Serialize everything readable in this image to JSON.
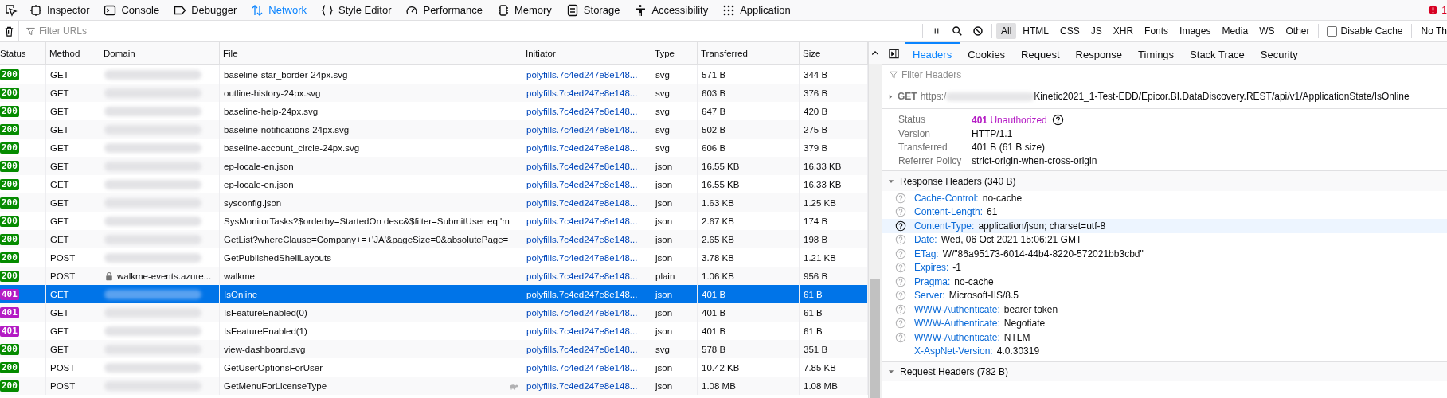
{
  "toolbox_tabs": [
    {
      "label": "Inspector",
      "selected": false
    },
    {
      "label": "Console",
      "selected": false
    },
    {
      "label": "Debugger",
      "selected": false
    },
    {
      "label": "Network",
      "selected": true
    },
    {
      "label": "Style Editor",
      "selected": false
    },
    {
      "label": "Performance",
      "selected": false
    },
    {
      "label": "Memory",
      "selected": false
    },
    {
      "label": "Storage",
      "selected": false
    },
    {
      "label": "Accessibility",
      "selected": false
    },
    {
      "label": "Application",
      "selected": false
    }
  ],
  "error_count": "1",
  "filter_bar": {
    "placeholder": "Filter URLs",
    "types": [
      {
        "label": "All",
        "selected": true
      },
      {
        "label": "HTML",
        "selected": false
      },
      {
        "label": "CSS",
        "selected": false
      },
      {
        "label": "JS",
        "selected": false
      },
      {
        "label": "XHR",
        "selected": false
      },
      {
        "label": "Fonts",
        "selected": false
      },
      {
        "label": "Images",
        "selected": false
      },
      {
        "label": "Media",
        "selected": false
      },
      {
        "label": "WS",
        "selected": false
      },
      {
        "label": "Other",
        "selected": false
      }
    ],
    "disable_cache": {
      "label": "Disable Cache",
      "checked": false
    },
    "throttle": "No Th"
  },
  "table": {
    "columns": [
      "Status",
      "Method",
      "Domain",
      "File",
      "Initiator",
      "Type",
      "Transferred",
      "Size"
    ],
    "rows": [
      {
        "status": "200",
        "color": "#058b00",
        "method": "GET",
        "domain_redacted": true,
        "file": "baseline-star_border-24px.svg",
        "initiator": "polyfills.7c4ed247e8e148...",
        "type": "svg",
        "transferred": "571 B",
        "size": "344 B",
        "selected": false
      },
      {
        "status": "200",
        "color": "#058b00",
        "method": "GET",
        "domain_redacted": true,
        "file": "outline-history-24px.svg",
        "initiator": "polyfills.7c4ed247e8e148...",
        "type": "svg",
        "transferred": "603 B",
        "size": "376 B",
        "selected": false
      },
      {
        "status": "200",
        "color": "#058b00",
        "method": "GET",
        "domain_redacted": true,
        "file": "baseline-help-24px.svg",
        "initiator": "polyfills.7c4ed247e8e148...",
        "type": "svg",
        "transferred": "647 B",
        "size": "420 B",
        "selected": false
      },
      {
        "status": "200",
        "color": "#058b00",
        "method": "GET",
        "domain_redacted": true,
        "file": "baseline-notifications-24px.svg",
        "initiator": "polyfills.7c4ed247e8e148...",
        "type": "svg",
        "transferred": "502 B",
        "size": "275 B",
        "selected": false
      },
      {
        "status": "200",
        "color": "#058b00",
        "method": "GET",
        "domain_redacted": true,
        "file": "baseline-account_circle-24px.svg",
        "initiator": "polyfills.7c4ed247e8e148...",
        "type": "svg",
        "transferred": "606 B",
        "size": "379 B",
        "selected": false
      },
      {
        "status": "200",
        "color": "#058b00",
        "method": "GET",
        "domain_redacted": true,
        "file": "ep-locale-en.json",
        "initiator": "polyfills.7c4ed247e8e148...",
        "type": "json",
        "transferred": "16.55 KB",
        "size": "16.33 KB",
        "selected": false
      },
      {
        "status": "200",
        "color": "#058b00",
        "method": "GET",
        "domain_redacted": true,
        "file": "ep-locale-en.json",
        "initiator": "polyfills.7c4ed247e8e148...",
        "type": "json",
        "transferred": "16.55 KB",
        "size": "16.33 KB",
        "selected": false
      },
      {
        "status": "200",
        "color": "#058b00",
        "method": "GET",
        "domain_redacted": true,
        "file": "sysconfig.json",
        "initiator": "polyfills.7c4ed247e8e148...",
        "type": "json",
        "transferred": "1.63 KB",
        "size": "1.25 KB",
        "selected": false
      },
      {
        "status": "200",
        "color": "#058b00",
        "method": "GET",
        "domain_redacted": true,
        "file": "SysMonitorTasks?$orderby=StartedOn desc&$filter=SubmitUser eq 'm",
        "initiator": "polyfills.7c4ed247e8e148...",
        "type": "json",
        "transferred": "2.67 KB",
        "size": "174 B",
        "selected": false
      },
      {
        "status": "200",
        "color": "#058b00",
        "method": "GET",
        "domain_redacted": true,
        "file": "GetList?whereClause=Company+=+'JA'&pageSize=0&absolutePage=",
        "initiator": "polyfills.7c4ed247e8e148...",
        "type": "json",
        "transferred": "2.65 KB",
        "size": "198 B",
        "selected": false
      },
      {
        "status": "200",
        "color": "#058b00",
        "method": "POST",
        "domain_redacted": true,
        "file": "GetPublishedShellLayouts",
        "initiator": "polyfills.7c4ed247e8e148...",
        "type": "json",
        "transferred": "3.78 KB",
        "size": "1.21 KB",
        "selected": false
      },
      {
        "status": "200",
        "color": "#058b00",
        "method": "POST",
        "domain_redacted": false,
        "domain": "walkme-events.azure...",
        "file": "walkme",
        "initiator": "polyfills.7c4ed247e8e148...",
        "type": "plain",
        "transferred": "1.06 KB",
        "size": "956 B",
        "selected": false
      },
      {
        "status": "401",
        "color": "#b41bc4",
        "method": "GET",
        "domain_redacted": true,
        "file": "IsOnline",
        "initiator": "polyfills.7c4ed247e8e148...",
        "type": "json",
        "transferred": "401 B",
        "size": "61 B",
        "selected": true
      },
      {
        "status": "401",
        "color": "#b41bc4",
        "method": "GET",
        "domain_redacted": true,
        "file": "IsFeatureEnabled(0)",
        "initiator": "polyfills.7c4ed247e8e148...",
        "type": "json",
        "transferred": "401 B",
        "size": "61 B",
        "selected": false
      },
      {
        "status": "401",
        "color": "#b41bc4",
        "method": "GET",
        "domain_redacted": true,
        "file": "IsFeatureEnabled(1)",
        "initiator": "polyfills.7c4ed247e8e148...",
        "type": "json",
        "transferred": "401 B",
        "size": "61 B",
        "selected": false
      },
      {
        "status": "200",
        "color": "#058b00",
        "method": "GET",
        "domain_redacted": true,
        "file": "view-dashboard.svg",
        "initiator": "polyfills.7c4ed247e8e148...",
        "type": "svg",
        "transferred": "578 B",
        "size": "351 B",
        "selected": false
      },
      {
        "status": "200",
        "color": "#058b00",
        "method": "POST",
        "domain_redacted": true,
        "file": "GetUserOptionsForUser",
        "initiator": "polyfills.7c4ed247e8e148...",
        "type": "json",
        "transferred": "10.42 KB",
        "size": "7.85 KB",
        "selected": false
      },
      {
        "status": "200",
        "color": "#058b00",
        "method": "POST",
        "domain_redacted": true,
        "file": "GetMenuForLicenseType",
        "slow": true,
        "initiator": "polyfills.7c4ed247e8e148...",
        "type": "json",
        "transferred": "1.08 MB",
        "size": "1.08 MB",
        "selected": false
      }
    ]
  },
  "details": {
    "tabs": [
      {
        "label": "Headers",
        "selected": true
      },
      {
        "label": "Cookies",
        "selected": false
      },
      {
        "label": "Request",
        "selected": false
      },
      {
        "label": "Response",
        "selected": false
      },
      {
        "label": "Timings",
        "selected": false
      },
      {
        "label": "Stack Trace",
        "selected": false
      },
      {
        "label": "Security",
        "selected": false
      }
    ],
    "filter_placeholder": "Filter Headers",
    "request": {
      "method": "GET",
      "url_start": "https:/",
      "url_end": "Kinetic2021_1-Test-EDD/Epicor.BI.DataDiscovery.REST/api/v1/ApplicationState/IsOnline"
    },
    "summary": [
      {
        "kind": "status",
        "label": "Status",
        "code": "401",
        "value": "Unauthorized"
      },
      {
        "kind": "text",
        "label": "Version",
        "value": "HTTP/1.1"
      },
      {
        "kind": "text",
        "label": "Transferred",
        "value": "401 B (61 B size)"
      },
      {
        "kind": "text",
        "label": "Referrer Policy",
        "value": "strict-origin-when-cross-origin"
      }
    ],
    "response_headers": {
      "title": "Response Headers (340 B)",
      "expanded": true,
      "items": [
        {
          "name": "Cache-Control:",
          "value": "no-cache",
          "help": true,
          "highlighted": false
        },
        {
          "name": "Content-Length:",
          "value": "61",
          "help": true,
          "highlighted": false
        },
        {
          "name": "Content-Type:",
          "value": "application/json; charset=utf-8",
          "help": true,
          "highlighted": true
        },
        {
          "name": "Date:",
          "value": "Wed, 06 Oct 2021 15:06:21 GMT",
          "help": true,
          "highlighted": false
        },
        {
          "name": "ETag:",
          "value": "W/\"86a95173-6014-44b4-8220-572021bb3cbd\"",
          "help": true,
          "highlighted": false
        },
        {
          "name": "Expires:",
          "value": "-1",
          "help": true,
          "highlighted": false
        },
        {
          "name": "Pragma:",
          "value": "no-cache",
          "help": true,
          "highlighted": false
        },
        {
          "name": "Server:",
          "value": "Microsoft-IIS/8.5",
          "help": true,
          "highlighted": false
        },
        {
          "name": "WWW-Authenticate:",
          "value": "bearer token",
          "help": true,
          "highlighted": false
        },
        {
          "name": "WWW-Authenticate:",
          "value": "Negotiate",
          "help": true,
          "highlighted": false
        },
        {
          "name": "WWW-Authenticate:",
          "value": "NTLM",
          "help": true,
          "highlighted": false
        },
        {
          "name": "X-AspNet-Version:",
          "value": "4.0.30319",
          "help": false,
          "highlighted": false
        }
      ]
    },
    "request_headers": {
      "title": "Request Headers (782 B)",
      "expanded": true
    }
  }
}
